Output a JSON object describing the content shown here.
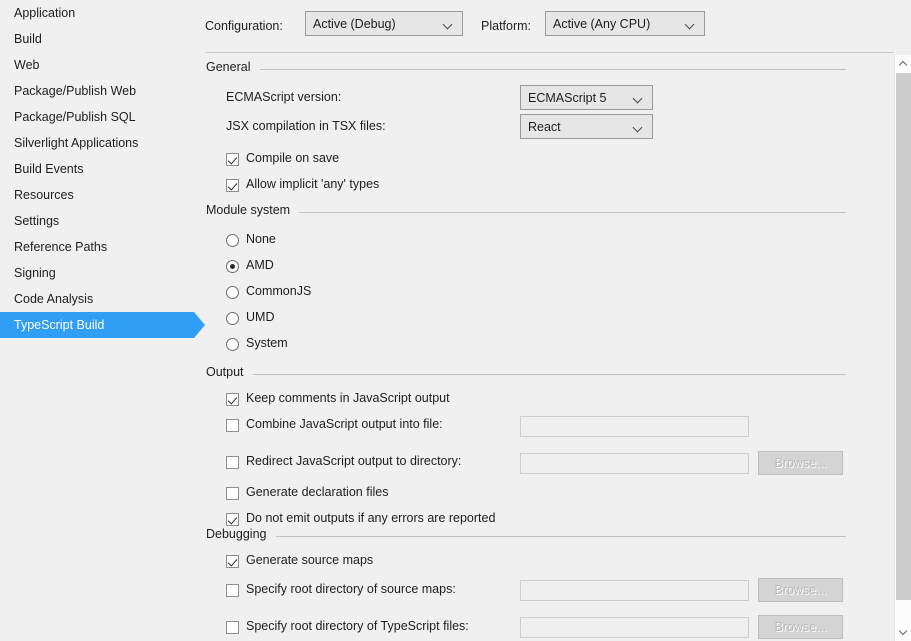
{
  "sidebar": {
    "items": [
      {
        "label": "Application",
        "selected": false
      },
      {
        "label": "Build",
        "selected": false
      },
      {
        "label": "Web",
        "selected": false
      },
      {
        "label": "Package/Publish Web",
        "selected": false
      },
      {
        "label": "Package/Publish SQL",
        "selected": false
      },
      {
        "label": "Silverlight Applications",
        "selected": false
      },
      {
        "label": "Build Events",
        "selected": false
      },
      {
        "label": "Resources",
        "selected": false
      },
      {
        "label": "Settings",
        "selected": false
      },
      {
        "label": "Reference Paths",
        "selected": false
      },
      {
        "label": "Signing",
        "selected": false
      },
      {
        "label": "Code Analysis",
        "selected": false
      },
      {
        "label": "TypeScript Build",
        "selected": true
      }
    ],
    "selected_label": "TypeScript Build",
    "accent_color": "#2f9ef4"
  },
  "topbar": {
    "configuration_label": "Configuration:",
    "configuration_value": "Active (Debug)",
    "platform_label": "Platform:",
    "platform_value": "Active (Any CPU)"
  },
  "general": {
    "title": "General",
    "ecmascript_label": "ECMAScript version:",
    "ecmascript_value": "ECMAScript 5",
    "jsx_label": "JSX compilation in TSX files:",
    "jsx_value": "React",
    "compile_on_save": {
      "label": "Compile on save",
      "checked": true
    },
    "allow_implicit_any": {
      "label": "Allow implicit 'any' types",
      "checked": true
    }
  },
  "module_system": {
    "title": "Module system",
    "selected": "AMD",
    "options": [
      {
        "label": "None",
        "checked": false
      },
      {
        "label": "AMD",
        "checked": true
      },
      {
        "label": "CommonJS",
        "checked": false
      },
      {
        "label": "UMD",
        "checked": false
      },
      {
        "label": "System",
        "checked": false
      }
    ]
  },
  "output": {
    "title": "Output",
    "keep_comments": {
      "label": "Keep comments in JavaScript output",
      "checked": true
    },
    "combine_output": {
      "label": "Combine JavaScript output into file:",
      "checked": false,
      "value": ""
    },
    "redirect_output": {
      "label": "Redirect JavaScript output to directory:",
      "checked": false,
      "value": "",
      "browse_label": "Browse..."
    },
    "generate_decls": {
      "label": "Generate declaration files",
      "checked": false
    },
    "no_emit_on_error": {
      "label": "Do not emit outputs if any errors are reported",
      "checked": true
    }
  },
  "debugging": {
    "title": "Debugging",
    "generate_source_maps": {
      "label": "Generate source maps",
      "checked": true
    },
    "source_map_root": {
      "label": "Specify root directory of source maps:",
      "checked": false,
      "value": "",
      "browse_label": "Browse..."
    },
    "ts_files_root": {
      "label": "Specify root directory of TypeScript files:",
      "checked": false,
      "value": "",
      "browse_label": "Browse..."
    }
  }
}
